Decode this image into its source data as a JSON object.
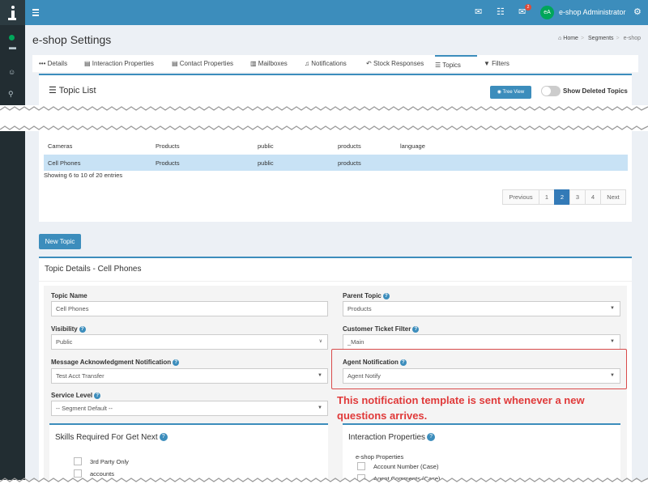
{
  "header": {
    "user_initials": "eA",
    "user_name": "e-shop Administrator",
    "notification_count": "2",
    "brand_color": "#3c8dbc"
  },
  "page": {
    "title": "e-shop Settings",
    "breadcrumb": [
      "Home",
      "Segments",
      "e-shop"
    ]
  },
  "tabs": [
    "Details",
    "Interaction Properties",
    "Contact Properties",
    "Mailboxes",
    "Notifications",
    "Stock Responses",
    "Topics",
    "Filters"
  ],
  "topic_list": {
    "title": "Topic List",
    "tree_view_label": "Tree View",
    "show_deleted_label": "Show Deleted Topics"
  },
  "table": {
    "rows": [
      [
        "Cameras",
        "Products",
        "public",
        "products",
        "language"
      ],
      [
        "Cell Phones",
        "Products",
        "public",
        "products",
        ""
      ]
    ],
    "showing": "Showing 6 to 10 of 20 entries",
    "pager": [
      "Previous",
      "1",
      "2",
      "3",
      "4",
      "Next"
    ]
  },
  "new_topic_label": "New Topic",
  "details": {
    "title": "Topic Details - Cell Phones",
    "topic_name_label": "Topic Name",
    "topic_name_value": "Cell Phones",
    "parent_topic_label": "Parent Topic",
    "parent_topic_value": "Products",
    "visibility_label": "Visibility",
    "visibility_value": "Public",
    "customer_filter_label": "Customer Ticket Filter",
    "customer_filter_value": "_Main",
    "ack_label": "Message Acknowledgment Notification",
    "ack_value": "Test Acct Transfer",
    "agent_notif_label": "Agent Notification",
    "agent_notif_value": "Agent Notify",
    "service_level_label": "Service Level",
    "service_level_value": "-- Segment Default --",
    "skills_title": "Skills Required For Get Next",
    "skills": [
      "3rd Party Only",
      "accounts"
    ],
    "interaction_title": "Interaction Properties",
    "interaction_group": "e-shop Properties",
    "interaction_items": [
      "Account Number (Case)",
      "Agent Comments (Case)"
    ]
  },
  "callout": "This notification template is sent whenever a new questions arrives."
}
